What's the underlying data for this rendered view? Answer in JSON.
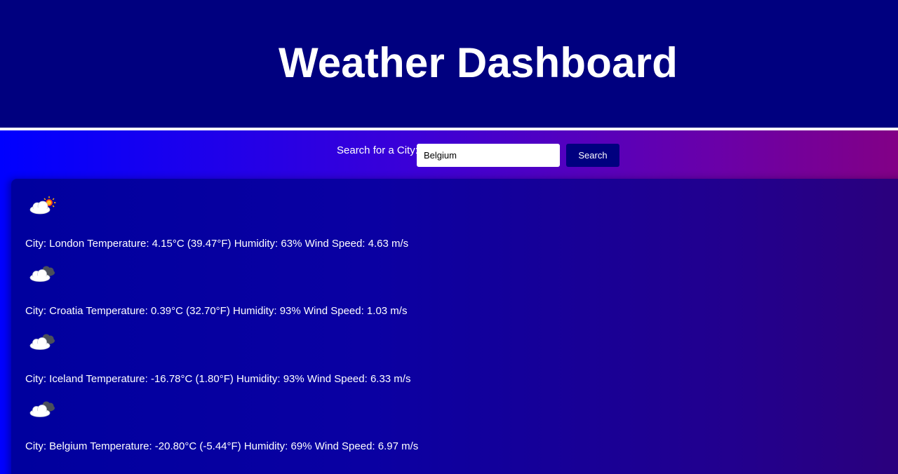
{
  "header": {
    "title": "Weather Dashboard"
  },
  "search": {
    "label": "Search for a City:",
    "value": "Belgium",
    "button_label": "Search"
  },
  "colors": {
    "header_bg": "#00007f",
    "button_bg": "#00007f",
    "text": "#ffffff"
  },
  "results": [
    {
      "icon": "cloud-sun-icon",
      "text": "City: London Temperature: 4.15°C (39.47°F) Humidity: 63% Wind Speed: 4.63 m/s"
    },
    {
      "icon": "cloud-icon",
      "text": "City: Croatia Temperature: 0.39°C (32.70°F) Humidity: 93% Wind Speed: 1.03 m/s"
    },
    {
      "icon": "cloud-icon",
      "text": "City: Iceland Temperature: -16.78°C (1.80°F) Humidity: 93% Wind Speed: 6.33 m/s"
    },
    {
      "icon": "cloud-icon",
      "text": "City: Belgium Temperature: -20.80°C (-5.44°F) Humidity: 69% Wind Speed: 6.97 m/s"
    }
  ]
}
